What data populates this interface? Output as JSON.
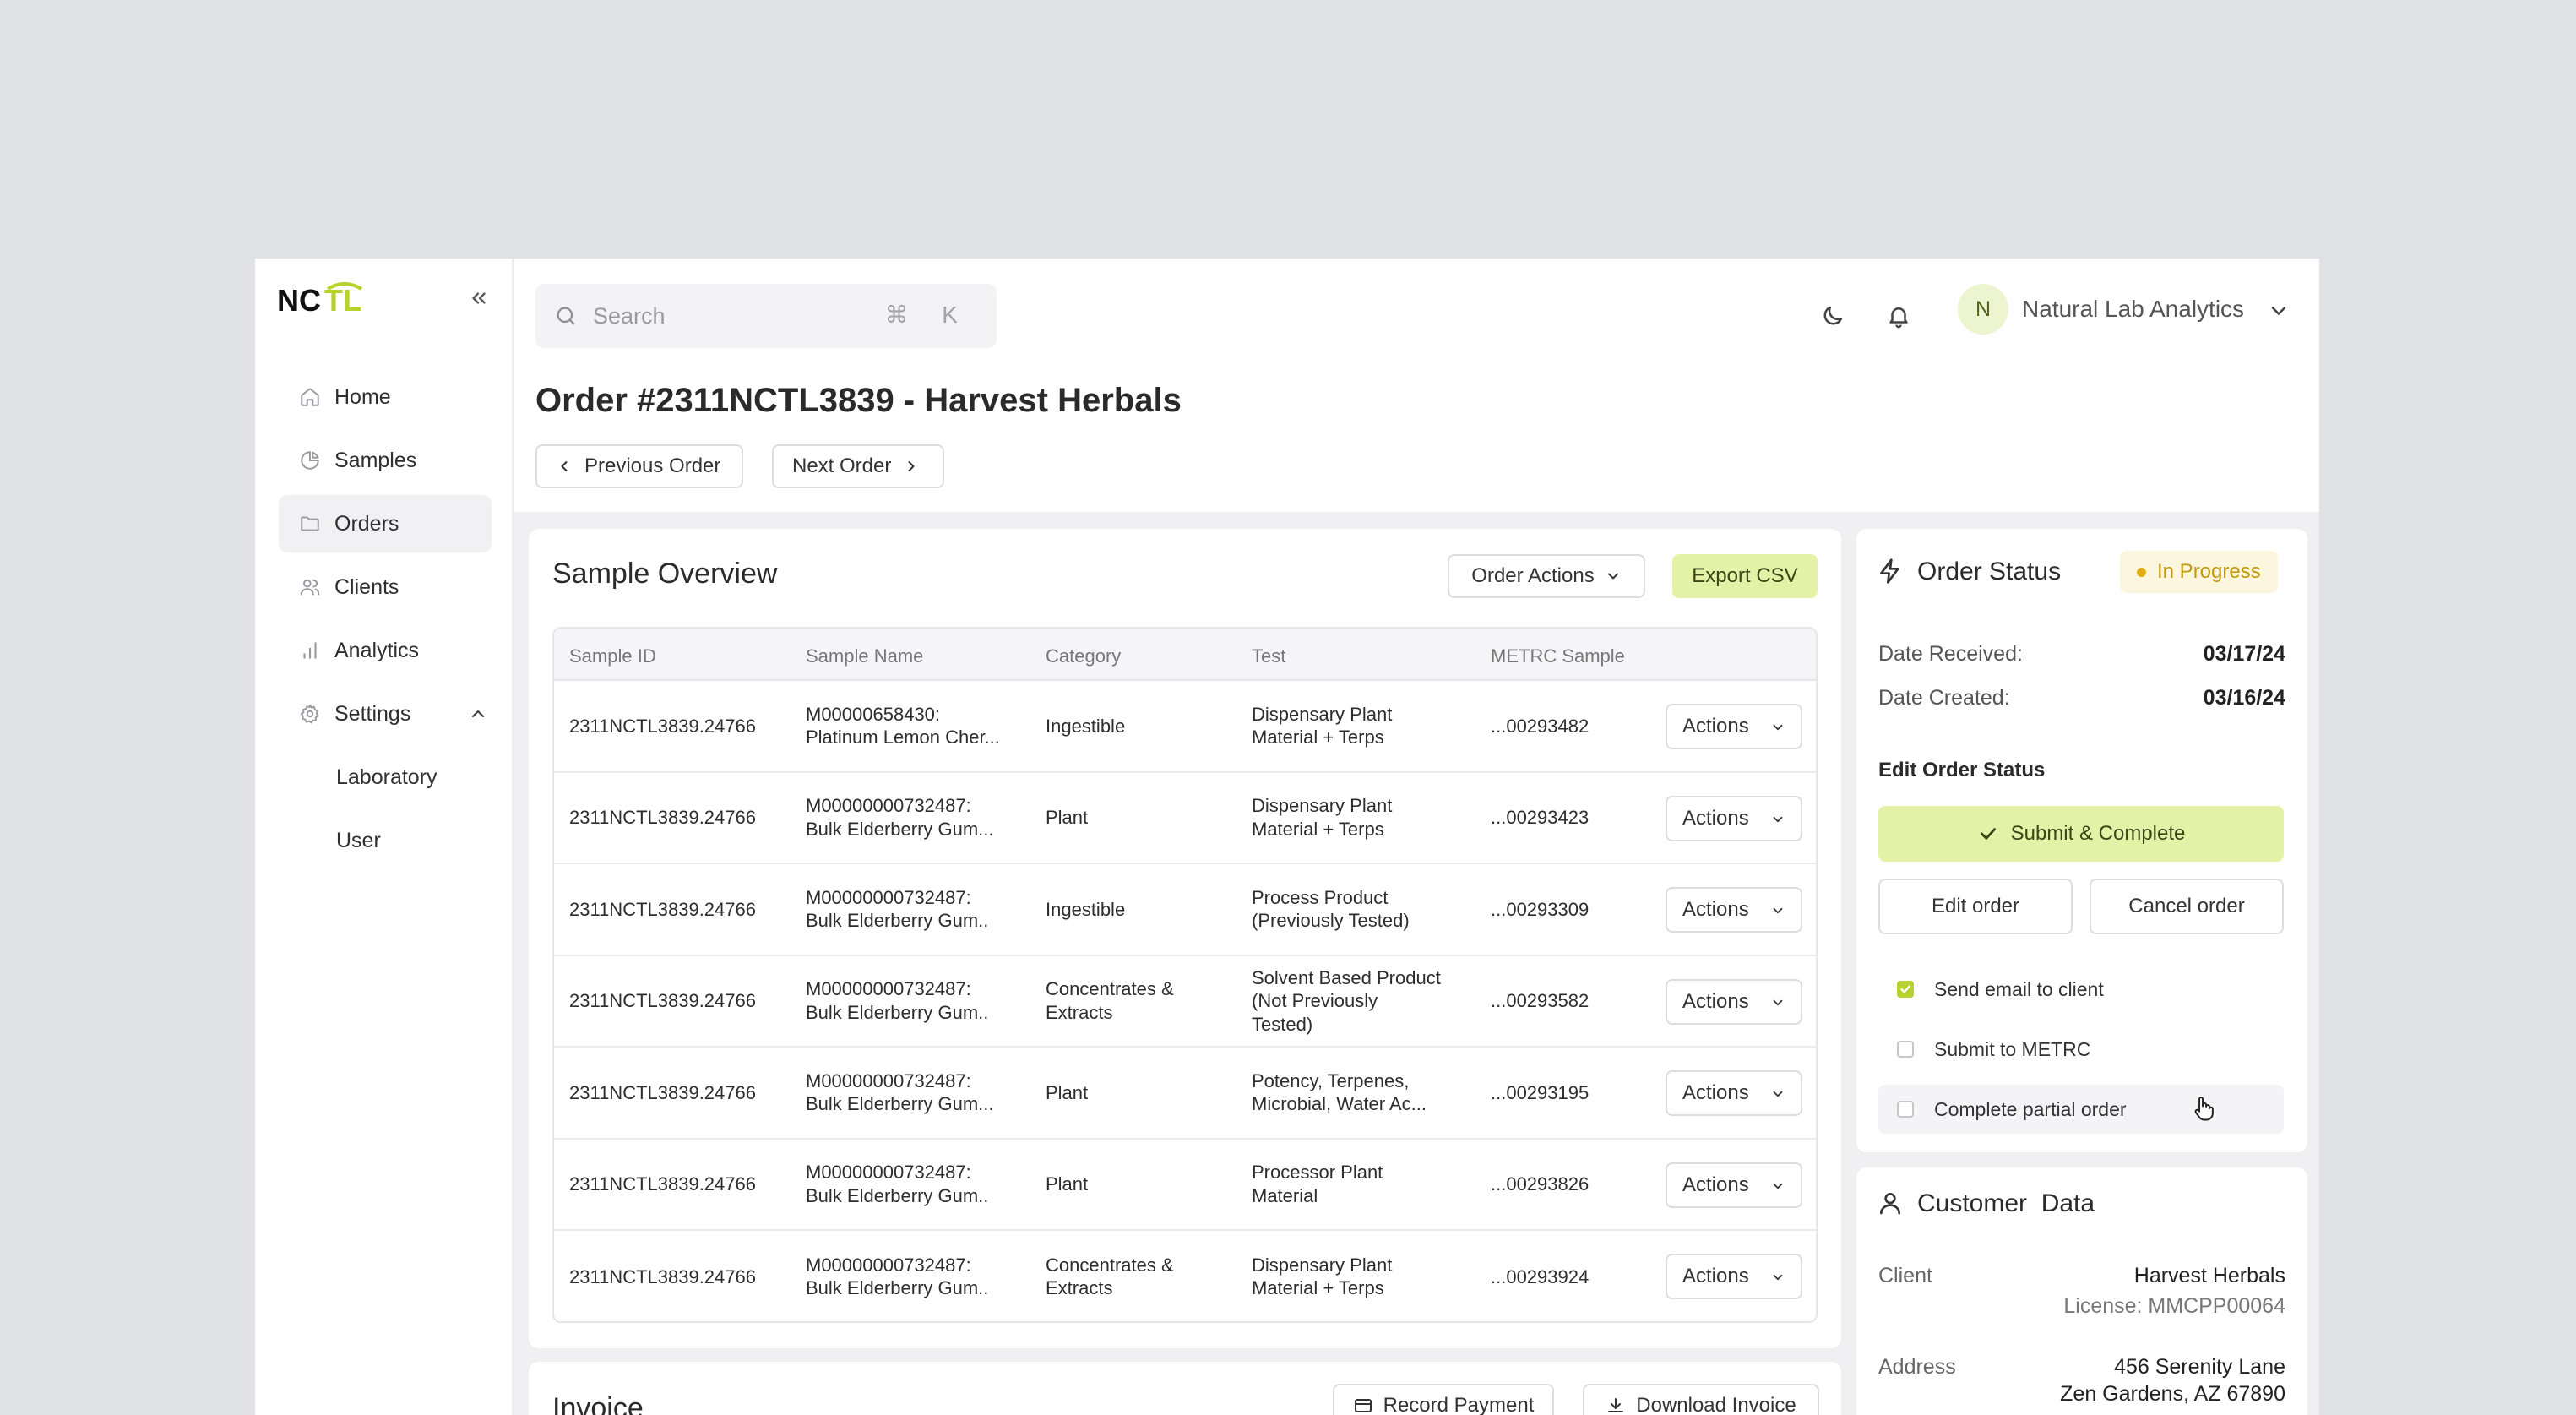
{
  "colors": {
    "accent_lime": "#e4f2a8",
    "brand_lime": "#b6d22c",
    "status_yellow": "#c39a0e",
    "page_bg": "#e1e2e6"
  },
  "sidebar": {
    "logo_text": "NCTL",
    "collapse_icon": "double-chevron-left-icon",
    "items": [
      {
        "label": "Home",
        "icon": "home-icon"
      },
      {
        "label": "Samples",
        "icon": "pie-chart-icon"
      },
      {
        "label": "Orders",
        "icon": "folder-icon"
      },
      {
        "label": "Clients",
        "icon": "users-icon"
      },
      {
        "label": "Analytics",
        "icon": "bar-chart-icon"
      },
      {
        "label": "Settings",
        "icon": "gear-icon"
      }
    ],
    "settings_sub": [
      {
        "label": "Laboratory"
      },
      {
        "label": "User"
      }
    ]
  },
  "topbar": {
    "search_placeholder": "Search",
    "search_shortcut": "⌘ K",
    "user_initial": "N",
    "org_name": "Natural Lab Analytics"
  },
  "page": {
    "title": "Order #2311NCTL3839 - Harvest Herbals",
    "prev_label": "Previous Order",
    "next_label": "Next Order"
  },
  "sample_overview": {
    "title": "Sample Overview",
    "order_actions_label": "Order Actions",
    "export_label": "Export CSV",
    "columns": [
      "Sample ID",
      "Sample Name",
      "Category",
      "Test",
      "METRC Sample"
    ],
    "action_label": "Actions",
    "rows": [
      {
        "id": "2311NCTL3839.24766",
        "name1": "M00000658430:",
        "name2": "Platinum Lemon Cher...",
        "category": "Ingestible",
        "test1": "Dispensary Plant",
        "test2": "Material + Terps",
        "test3": "",
        "metrc": "...00293482"
      },
      {
        "id": "2311NCTL3839.24766",
        "name1": "M00000000732487:",
        "name2": "Bulk Elderberry Gum...",
        "category": "Plant",
        "test1": "Dispensary Plant",
        "test2": "Material + Terps",
        "test3": "",
        "metrc": "...00293423"
      },
      {
        "id": "2311NCTL3839.24766",
        "name1": "M00000000732487:",
        "name2": "Bulk Elderberry Gum..",
        "category": "Ingestible",
        "test1": "Process Product",
        "test2": "(Previously Tested)",
        "test3": "",
        "metrc": "...00293309"
      },
      {
        "id": "2311NCTL3839.24766",
        "name1": "M00000000732487:",
        "name2": "Bulk Elderberry Gum..",
        "category": "Concentrates & Extracts",
        "test1": "Solvent Based Product",
        "test2": "(Not Previously",
        "test3": "Tested)",
        "metrc": "...00293582"
      },
      {
        "id": "2311NCTL3839.24766",
        "name1": "M00000000732487:",
        "name2": "Bulk Elderberry Gum...",
        "category": "Plant",
        "test1": "Potency, Terpenes,",
        "test2": "Microbial, Water Ac...",
        "test3": "",
        "metrc": "...00293195"
      },
      {
        "id": "2311NCTL3839.24766",
        "name1": "M00000000732487:",
        "name2": "Bulk Elderberry Gum..",
        "category": "Plant",
        "test1": "Processor Plant",
        "test2": "Material",
        "test3": "",
        "metrc": "...00293826"
      },
      {
        "id": "2311NCTL3839.24766",
        "name1": "M00000000732487:",
        "name2": "Bulk Elderberry Gum..",
        "category": "Concentrates & Extracts",
        "test1": "Dispensary Plant",
        "test2": "Material + Terps",
        "test3": "",
        "metrc": "...00293924"
      }
    ]
  },
  "invoice": {
    "title": "Invoice",
    "record_payment_label": "Record Payment",
    "download_label": "Download Invoice"
  },
  "order_status": {
    "title": "Order Status",
    "status_badge": "In Progress",
    "date_received_label": "Date Received:",
    "date_received": "03/17/24",
    "date_created_label": "Date Created:",
    "date_created": "03/16/24",
    "edit_heading": "Edit Order Status",
    "submit_label": "Submit & Complete",
    "edit_label": "Edit order",
    "cancel_label": "Cancel order",
    "options": [
      {
        "label": "Send email to client",
        "checked": true
      },
      {
        "label": "Submit to METRC",
        "checked": false
      },
      {
        "label": "Complete partial order",
        "checked": false
      }
    ]
  },
  "customer": {
    "title": "Customer  Data",
    "client_label": "Client",
    "client_name": "Harvest Herbals",
    "license": "License: MMCPP00064",
    "address_label": "Address",
    "address_line1": "456 Serenity Lane",
    "address_line2": "Zen Gardens, AZ 67890"
  }
}
